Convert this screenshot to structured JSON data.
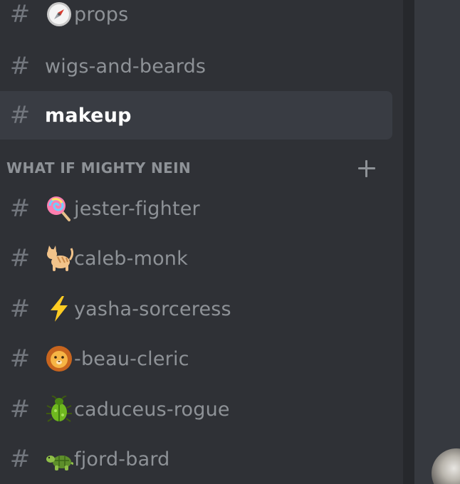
{
  "channels_top": [
    {
      "name": "props",
      "icon": "compass-icon",
      "selected": false
    },
    {
      "name": "wigs-and-beards",
      "icon": null,
      "selected": false
    },
    {
      "name": "makeup",
      "icon": null,
      "selected": true
    }
  ],
  "category": {
    "label": "WHAT IF MIGHTY NEIN",
    "add_icon": "plus-icon"
  },
  "channels_bottom": [
    {
      "name": "jester-fighter",
      "icon": "lollipop-icon"
    },
    {
      "name": "caleb-monk",
      "icon": "cat-icon"
    },
    {
      "name": "yasha-sorceress",
      "icon": "lightning-icon"
    },
    {
      "name": "-beau-cleric",
      "icon": "lion-icon"
    },
    {
      "name": "caduceus-rogue",
      "icon": "beetle-icon"
    },
    {
      "name": "fjord-bard",
      "icon": "turtle-icon"
    }
  ],
  "colors": {
    "sidebar_bg": "#2f3136",
    "selected_bg": "#393c43",
    "muted_text": "#8e9297",
    "hash": "#72767d",
    "selected_text": "#ffffff"
  }
}
